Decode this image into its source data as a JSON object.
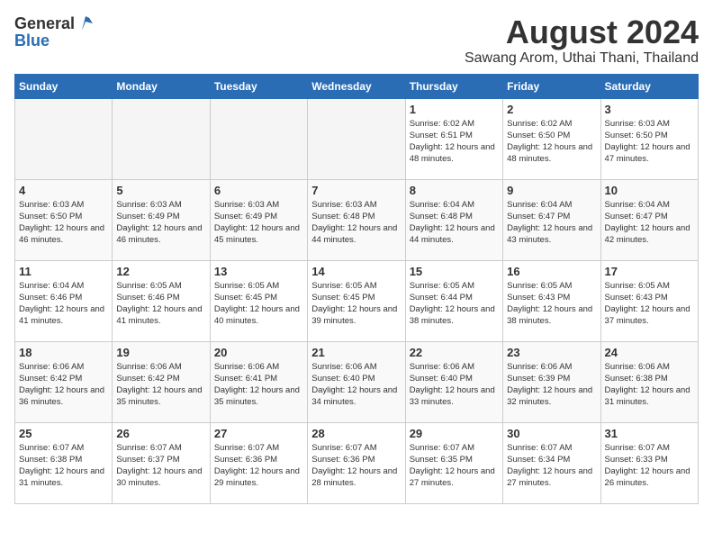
{
  "header": {
    "logo_general": "General",
    "logo_blue": "Blue",
    "title": "August 2024",
    "subtitle": "Sawang Arom, Uthai Thani, Thailand"
  },
  "days_of_week": [
    "Sunday",
    "Monday",
    "Tuesday",
    "Wednesday",
    "Thursday",
    "Friday",
    "Saturday"
  ],
  "weeks": [
    [
      {
        "day": "",
        "empty": true
      },
      {
        "day": "",
        "empty": true
      },
      {
        "day": "",
        "empty": true
      },
      {
        "day": "",
        "empty": true
      },
      {
        "day": "1",
        "sunrise": "6:02 AM",
        "sunset": "6:51 PM",
        "daylight": "12 hours and 48 minutes."
      },
      {
        "day": "2",
        "sunrise": "6:02 AM",
        "sunset": "6:50 PM",
        "daylight": "12 hours and 48 minutes."
      },
      {
        "day": "3",
        "sunrise": "6:03 AM",
        "sunset": "6:50 PM",
        "daylight": "12 hours and 47 minutes."
      }
    ],
    [
      {
        "day": "4",
        "sunrise": "6:03 AM",
        "sunset": "6:50 PM",
        "daylight": "12 hours and 46 minutes."
      },
      {
        "day": "5",
        "sunrise": "6:03 AM",
        "sunset": "6:49 PM",
        "daylight": "12 hours and 46 minutes."
      },
      {
        "day": "6",
        "sunrise": "6:03 AM",
        "sunset": "6:49 PM",
        "daylight": "12 hours and 45 minutes."
      },
      {
        "day": "7",
        "sunrise": "6:03 AM",
        "sunset": "6:48 PM",
        "daylight": "12 hours and 44 minutes."
      },
      {
        "day": "8",
        "sunrise": "6:04 AM",
        "sunset": "6:48 PM",
        "daylight": "12 hours and 44 minutes."
      },
      {
        "day": "9",
        "sunrise": "6:04 AM",
        "sunset": "6:47 PM",
        "daylight": "12 hours and 43 minutes."
      },
      {
        "day": "10",
        "sunrise": "6:04 AM",
        "sunset": "6:47 PM",
        "daylight": "12 hours and 42 minutes."
      }
    ],
    [
      {
        "day": "11",
        "sunrise": "6:04 AM",
        "sunset": "6:46 PM",
        "daylight": "12 hours and 41 minutes."
      },
      {
        "day": "12",
        "sunrise": "6:05 AM",
        "sunset": "6:46 PM",
        "daylight": "12 hours and 41 minutes."
      },
      {
        "day": "13",
        "sunrise": "6:05 AM",
        "sunset": "6:45 PM",
        "daylight": "12 hours and 40 minutes."
      },
      {
        "day": "14",
        "sunrise": "6:05 AM",
        "sunset": "6:45 PM",
        "daylight": "12 hours and 39 minutes."
      },
      {
        "day": "15",
        "sunrise": "6:05 AM",
        "sunset": "6:44 PM",
        "daylight": "12 hours and 38 minutes."
      },
      {
        "day": "16",
        "sunrise": "6:05 AM",
        "sunset": "6:43 PM",
        "daylight": "12 hours and 38 minutes."
      },
      {
        "day": "17",
        "sunrise": "6:05 AM",
        "sunset": "6:43 PM",
        "daylight": "12 hours and 37 minutes."
      }
    ],
    [
      {
        "day": "18",
        "sunrise": "6:06 AM",
        "sunset": "6:42 PM",
        "daylight": "12 hours and 36 minutes."
      },
      {
        "day": "19",
        "sunrise": "6:06 AM",
        "sunset": "6:42 PM",
        "daylight": "12 hours and 35 minutes."
      },
      {
        "day": "20",
        "sunrise": "6:06 AM",
        "sunset": "6:41 PM",
        "daylight": "12 hours and 35 minutes."
      },
      {
        "day": "21",
        "sunrise": "6:06 AM",
        "sunset": "6:40 PM",
        "daylight": "12 hours and 34 minutes."
      },
      {
        "day": "22",
        "sunrise": "6:06 AM",
        "sunset": "6:40 PM",
        "daylight": "12 hours and 33 minutes."
      },
      {
        "day": "23",
        "sunrise": "6:06 AM",
        "sunset": "6:39 PM",
        "daylight": "12 hours and 32 minutes."
      },
      {
        "day": "24",
        "sunrise": "6:06 AM",
        "sunset": "6:38 PM",
        "daylight": "12 hours and 31 minutes."
      }
    ],
    [
      {
        "day": "25",
        "sunrise": "6:07 AM",
        "sunset": "6:38 PM",
        "daylight": "12 hours and 31 minutes."
      },
      {
        "day": "26",
        "sunrise": "6:07 AM",
        "sunset": "6:37 PM",
        "daylight": "12 hours and 30 minutes."
      },
      {
        "day": "27",
        "sunrise": "6:07 AM",
        "sunset": "6:36 PM",
        "daylight": "12 hours and 29 minutes."
      },
      {
        "day": "28",
        "sunrise": "6:07 AM",
        "sunset": "6:36 PM",
        "daylight": "12 hours and 28 minutes."
      },
      {
        "day": "29",
        "sunrise": "6:07 AM",
        "sunset": "6:35 PM",
        "daylight": "12 hours and 27 minutes."
      },
      {
        "day": "30",
        "sunrise": "6:07 AM",
        "sunset": "6:34 PM",
        "daylight": "12 hours and 27 minutes."
      },
      {
        "day": "31",
        "sunrise": "6:07 AM",
        "sunset": "6:33 PM",
        "daylight": "12 hours and 26 minutes."
      }
    ]
  ]
}
